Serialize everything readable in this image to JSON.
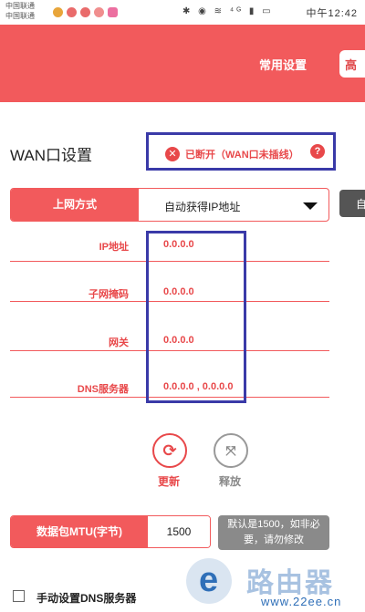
{
  "status_bar": {
    "carrier_1": "中国联通",
    "carrier_2": "中国联通",
    "sys_icons": "✱ ◉ ≋ ⁴ᴳ ▮ ▭",
    "time": "中午12:42"
  },
  "header": {
    "nav_common": "常用设置",
    "nav_advanced": "高"
  },
  "page_title": "WAN口设置",
  "wan_status": {
    "text": "已断开（WAN口未插线）",
    "icon": "close-circle-icon",
    "help_icon": "help-circle-icon"
  },
  "connection": {
    "label": "上网方式",
    "value": "自动获得IP地址",
    "auto_button": "自"
  },
  "info": [
    {
      "label": "IP地址",
      "value": "0.0.0.0"
    },
    {
      "label": "子网掩码",
      "value": "0.0.0.0"
    },
    {
      "label": "网关",
      "value": "0.0.0.0"
    },
    {
      "label": "DNS服务器",
      "value": "0.0.0.0 , 0.0.0.0"
    }
  ],
  "actions": {
    "refresh_label": "更新",
    "release_label": "释放"
  },
  "mtu": {
    "label": "数据包MTU(字节)",
    "value": "1500",
    "hint": "默认是1500，如非必要，请勿修改"
  },
  "dns_manual": {
    "label": "手动设置DNS服务器",
    "checked": false
  },
  "watermark": {
    "title": "路由器",
    "url": "www.22ee.cn"
  },
  "colors": {
    "accent": "#f25a5c",
    "accent_text": "#e8484a",
    "highlight_box": "#3a3aa8"
  }
}
